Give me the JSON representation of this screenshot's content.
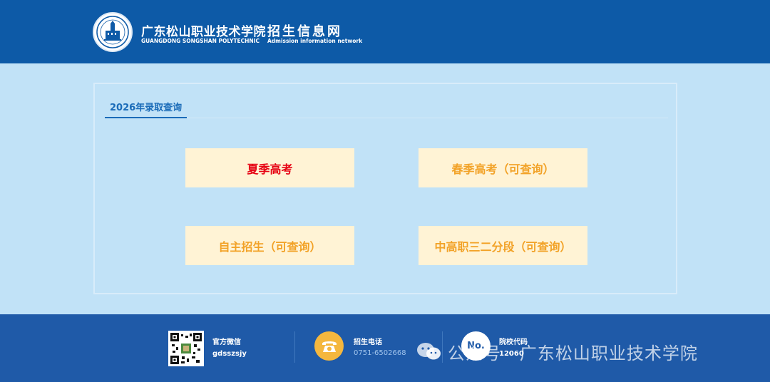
{
  "header": {
    "school_name_cn": "广东松山职业技术学院",
    "school_name_en": "GUANGDONG SONGSHAN POLYTECHNIC",
    "site_name_cn": "招生信息网",
    "site_name_en": "Admission information network",
    "logo_icon": "school-seal-icon"
  },
  "panel": {
    "tab_label": "2026年录取查询",
    "buttons": {
      "summer": "夏季高考",
      "spring": "春季高考（可查询）",
      "autonomous": "自主招生（可查询）",
      "vocational": "中高职三二分段（可查询）"
    }
  },
  "footer": {
    "wechat_label": "官方微信",
    "wechat_id": "gdsszsjy",
    "phone_label": "招生电话",
    "phone_number": "0751-6502668",
    "code_badge": "No.",
    "code_label": "院校代码",
    "code_value": "12060"
  },
  "watermark": {
    "text": "公众号 · 广东松山职业技术学院"
  },
  "colors": {
    "header_bg": "#0d5aa7",
    "page_bg": "#c1e2f7",
    "button_bg": "#fff3d5",
    "summer_text": "#e60012",
    "other_text": "#f2a227",
    "footer_bg": "#1f5aa8",
    "phone_icon_bg": "#f4b73e"
  }
}
